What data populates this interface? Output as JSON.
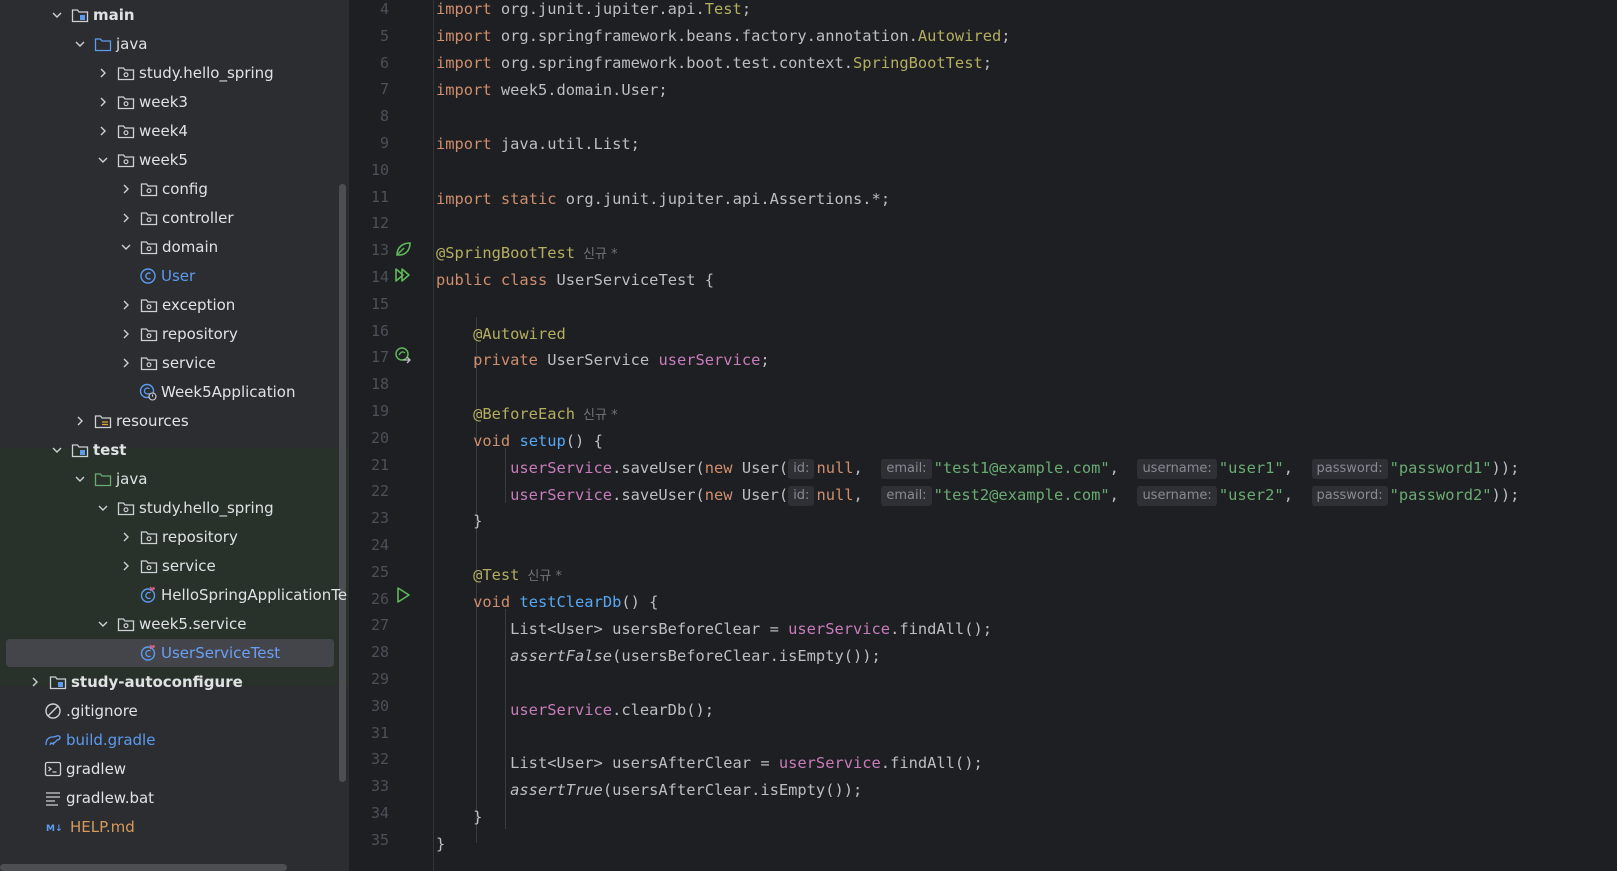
{
  "project_tree": {
    "items": [
      {
        "label": "main",
        "expanded": true,
        "icon": "module-folder-icon"
      },
      {
        "label": "java",
        "expanded": true,
        "icon": "source-folder-icon"
      },
      {
        "label": "study.hello_spring",
        "expanded": false,
        "icon": "package-icon"
      },
      {
        "label": "week3",
        "expanded": false,
        "icon": "package-icon"
      },
      {
        "label": "week4",
        "expanded": false,
        "icon": "package-icon"
      },
      {
        "label": "week5",
        "expanded": true,
        "icon": "package-icon"
      },
      {
        "label": "config",
        "expanded": false,
        "icon": "package-icon"
      },
      {
        "label": "controller",
        "expanded": false,
        "icon": "package-icon"
      },
      {
        "label": "domain",
        "expanded": true,
        "icon": "package-icon"
      },
      {
        "label": "User",
        "icon": "class-icon"
      },
      {
        "label": "exception",
        "expanded": false,
        "icon": "package-icon"
      },
      {
        "label": "repository",
        "expanded": false,
        "icon": "package-icon"
      },
      {
        "label": "service",
        "expanded": false,
        "icon": "package-icon"
      },
      {
        "label": "Week5Application",
        "icon": "spring-boot-class-icon"
      },
      {
        "label": "resources",
        "expanded": false,
        "icon": "resources-folder-icon"
      },
      {
        "label": "test",
        "expanded": true,
        "icon": "module-folder-icon"
      },
      {
        "label": "java",
        "expanded": true,
        "icon": "test-source-folder-icon"
      },
      {
        "label": "study.hello_spring",
        "expanded": true,
        "icon": "package-icon"
      },
      {
        "label": "repository",
        "expanded": false,
        "icon": "package-icon"
      },
      {
        "label": "service",
        "expanded": false,
        "icon": "package-icon"
      },
      {
        "label": "HelloSpringApplicationTe",
        "icon": "test-class-icon"
      },
      {
        "label": "week5.service",
        "expanded": true,
        "icon": "package-icon"
      },
      {
        "label": "UserServiceTest",
        "icon": "test-class-icon",
        "selected": true
      },
      {
        "label": "study-autoconfigure",
        "expanded": false,
        "icon": "module-folder-icon"
      },
      {
        "label": ".gitignore",
        "icon": "ignore-file-icon"
      },
      {
        "label": "build.gradle",
        "icon": "gradle-icon"
      },
      {
        "label": "gradlew",
        "icon": "terminal-script-icon"
      },
      {
        "label": "gradlew.bat",
        "icon": "text-file-icon"
      },
      {
        "label": "HELP.md",
        "icon": "markdown-icon"
      }
    ]
  },
  "editor": {
    "line_numbers": [
      "4",
      "5",
      "6",
      "7",
      "8",
      "9",
      "10",
      "11",
      "12",
      "13",
      "14",
      "15",
      "16",
      "17",
      "18",
      "19",
      "20",
      "21",
      "22",
      "23",
      "24",
      "25",
      "26",
      "27",
      "28",
      "29",
      "30",
      "31",
      "32",
      "33",
      "34",
      "35"
    ],
    "tokens": {
      "import": "import",
      "static": "static",
      "public": "public",
      "class": "class",
      "private": "private",
      "void": "void",
      "new": "new",
      "null": "null",
      "pkg_test": "org.junit.jupiter.api.",
      "Test": "Test",
      "pkg_autowired": "org.springframework.beans.factory.annotation.",
      "Autowired": "Autowired",
      "pkg_sbt": "org.springframework.boot.test.context.",
      "SpringBootTest": "SpringBootTest",
      "import_user": "week5.domain.User",
      "import_list": "java.util.List",
      "import_assert": "org.junit.jupiter.api.Assertions.*",
      "ann_sbt": "@SpringBootTest",
      "ann_autowired": "@Autowired",
      "ann_beforeeach": "@BeforeEach",
      "ann_test": "@Test",
      "new_marker": "신규 *",
      "class_name": "UserServiceTest {",
      "UserService": "UserService ",
      "userService": "userService",
      "setup": "setup",
      "testClearDb": "testClearDb",
      "saveUser": ".saveUser(",
      "User_open": "User(",
      "hint_id": "id:",
      "hint_email": "email:",
      "hint_username": "username:",
      "hint_password": "password:",
      "email1": "\"test1@example.com\"",
      "email2": "\"test2@example.com\"",
      "user1": "\"user1\"",
      "user2": "\"user2\"",
      "pw1": "\"password1\"",
      "pw2": "\"password2\"",
      "list_before": "List<User> usersBeforeClear = ",
      "list_after": "List<User> usersAfterClear = ",
      "findAll": ".findAll();",
      "assertFalse": "assertFalse",
      "assertTrue": "assertTrue",
      "before_empty": "(usersBeforeClear.isEmpty());",
      "after_empty": "(usersAfterClear.isEmpty());",
      "clearDb": ".clearDb();"
    }
  },
  "colors": {
    "keyword": "#cf8e6d",
    "annotation": "#b3ae60",
    "field": "#c77dbb",
    "method": "#56a8f5",
    "string": "#6aab73",
    "default": "#bcbec4"
  }
}
